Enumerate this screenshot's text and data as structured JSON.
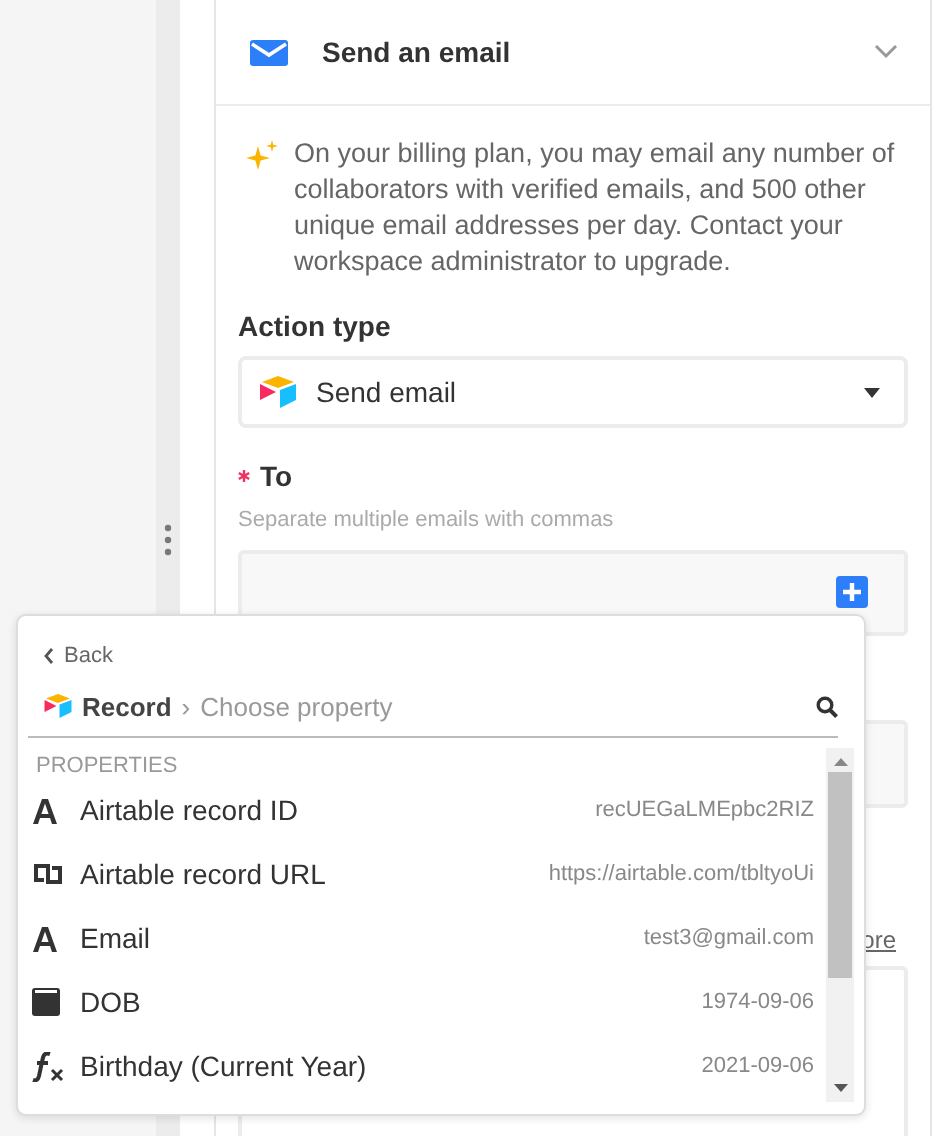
{
  "card": {
    "title": "Send an email",
    "expanded": true,
    "notice": "On your billing plan, you may email any number of collaborators with verified emails, and 500 other unique email addresses per day. Contact your workspace administrator to upgrade.",
    "action_type": {
      "label": "Action type",
      "value": "Send email"
    },
    "to": {
      "label": "To",
      "required": true,
      "hint": "Separate multiple emails with commas"
    },
    "link_fragment": "ore"
  },
  "popover": {
    "back": "Back",
    "breadcrumb": {
      "root": "Record",
      "separator": "›",
      "current": "Choose property"
    },
    "section": "PROPERTIES",
    "items": [
      {
        "kind": "text",
        "name": "Airtable record ID",
        "value": "recUEGaLMEpbc2RIZ"
      },
      {
        "kind": "url",
        "name": "Airtable record URL",
        "value": "https://airtable.com/tbltyoUi"
      },
      {
        "kind": "text",
        "name": "Email",
        "value": "test3@gmail.com"
      },
      {
        "kind": "date",
        "name": "DOB",
        "value": "1974-09-06"
      },
      {
        "kind": "formula",
        "name": "Birthday (Current Year)",
        "value": "2021-09-06"
      }
    ]
  }
}
